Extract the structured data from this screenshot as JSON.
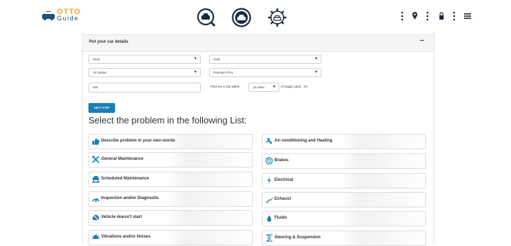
{
  "header": {
    "logo_line1": "OTTO",
    "logo_line2": "Guide",
    "nav_icons": [
      "search-car-icon",
      "car-circle-icon",
      "gear-car-icon"
    ],
    "top_icons": [
      "kebab-icon",
      "location-icon",
      "kebab-icon",
      "lock-icon",
      "kebab-icon",
      "menu-icon"
    ]
  },
  "form": {
    "title": "Put your car details",
    "collapse": "−",
    "year": "2015",
    "make": "Audi",
    "model": "A3 Sedan",
    "trim": "Premium Plus",
    "mileage": "300",
    "find_prefix": "Find me a Car within",
    "radius": "10 miles",
    "find_suffix": "of Sugar Land , TX",
    "next_label": "NEXT STEP"
  },
  "problems": {
    "heading": "Select the problem in the following List:",
    "left": [
      {
        "label": "Describe problem in your own words",
        "icon": "thumbs-up-icon"
      },
      {
        "label": "General Maintenance",
        "icon": "tools-icon"
      },
      {
        "label": "Scheduled Maintenance",
        "icon": "car-lift-icon"
      },
      {
        "label": "Inspection and/or Diagnostic",
        "icon": "diagnostic-icon"
      },
      {
        "label": "Vehicle doesn't start",
        "icon": "no-start-icon"
      },
      {
        "label": "Vibrations and/or Noises",
        "icon": "vibration-icon"
      }
    ],
    "right": [
      {
        "label": "Air-conditioning and Heating",
        "icon": "fan-icon"
      },
      {
        "label": "Brakes",
        "icon": "brake-icon"
      },
      {
        "label": "Electrical",
        "icon": "bolt-icon"
      },
      {
        "label": "Exhaust",
        "icon": "exhaust-icon"
      },
      {
        "label": "Fluids",
        "icon": "drop-icon"
      },
      {
        "label": "Steering & Suspension",
        "icon": "suspension-icon"
      }
    ]
  },
  "colors": {
    "accent": "#1a7fb4",
    "brand_orange": "#f5a623",
    "brand_navy": "#1f4e79"
  }
}
